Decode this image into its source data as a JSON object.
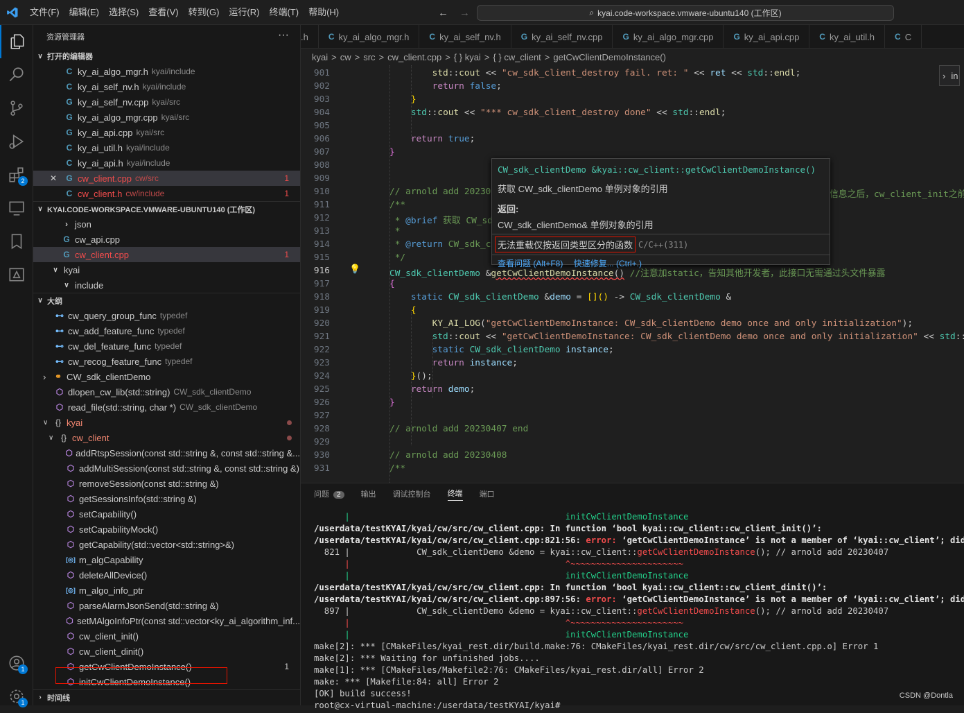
{
  "menu": [
    "文件(F)",
    "编辑(E)",
    "选择(S)",
    "查看(V)",
    "转到(G)",
    "运行(R)",
    "终端(T)",
    "帮助(H)"
  ],
  "title": "kyai.code-workspace.vmware-ubuntu140 (工作区)",
  "sidebar": {
    "header": "资源管理器",
    "open_editors_label": "打开的编辑器",
    "open_editors": [
      {
        "icon": "C",
        "name": "ky_ai_algo_mgr.h",
        "desc": "kyai/include"
      },
      {
        "icon": "C",
        "name": "ky_ai_self_nv.h",
        "desc": "kyai/include"
      },
      {
        "icon": "G",
        "name": "ky_ai_self_nv.cpp",
        "desc": "kyai/src"
      },
      {
        "icon": "G",
        "name": "ky_ai_algo_mgr.cpp",
        "desc": "kyai/src"
      },
      {
        "icon": "G",
        "name": "ky_ai_api.cpp",
        "desc": "kyai/src"
      },
      {
        "icon": "C",
        "name": "ky_ai_util.h",
        "desc": "kyai/include"
      },
      {
        "icon": "C",
        "name": "ky_ai_api.h",
        "desc": "kyai/include"
      },
      {
        "icon": "G",
        "name": "cw_client.cpp",
        "desc": "cw/src",
        "count": "1",
        "error": true
      },
      {
        "icon": "C",
        "name": "cw_client.h",
        "desc": "cw/include",
        "count": "1",
        "error": true
      }
    ],
    "workspace_label": "KYAI.CODE-WORKSPACE.VMWARE-UBUNTU140 (工作区)",
    "workspace_items": [
      {
        "name": "json",
        "kind": "folder"
      },
      {
        "name": "cw_api.cpp",
        "kind": "file"
      },
      {
        "name": "cw_client.cpp",
        "kind": "file",
        "count": "1"
      },
      {
        "name": "kyai",
        "kind": "folder-open"
      },
      {
        "name": "include",
        "kind": "folder-open"
      }
    ],
    "outline_label": "大纲",
    "outline": [
      {
        "name": "cw_query_group_func",
        "desc": "typedef",
        "kind": "td"
      },
      {
        "name": "cw_add_feature_func",
        "desc": "typedef",
        "kind": "td"
      },
      {
        "name": "cw_del_feature_func",
        "desc": "typedef",
        "kind": "td"
      },
      {
        "name": "cw_recog_feature_func",
        "desc": "typedef",
        "kind": "td"
      },
      {
        "name": "CW_sdk_clientDemo",
        "desc": "",
        "kind": "cls"
      },
      {
        "name": "dlopen_cw_lib(std::string)",
        "desc": "CW_sdk_clientDemo",
        "kind": "fn"
      },
      {
        "name": "read_file(std::string, char *)",
        "desc": "CW_sdk_clientDemo",
        "kind": "fn"
      },
      {
        "name": "kyai",
        "desc": "",
        "kind": "ns"
      },
      {
        "name": "cw_client",
        "desc": "",
        "kind": "ns"
      },
      {
        "name": "addRtspSession(const std::string &, const std::string &...",
        "desc": "",
        "kind": "fn"
      },
      {
        "name": "addMultiSession(const std::string &, const std::string &)",
        "desc": "",
        "kind": "fn"
      },
      {
        "name": "removeSession(const std::string &)",
        "desc": "",
        "kind": "fn"
      },
      {
        "name": "getSessionsInfo(std::string &)",
        "desc": "",
        "kind": "fn"
      },
      {
        "name": "setCapability()",
        "desc": "",
        "kind": "fn"
      },
      {
        "name": "setCapabilityMock()",
        "desc": "",
        "kind": "fn"
      },
      {
        "name": "getCapability(std::vector<std::string>&)",
        "desc": "",
        "kind": "fn"
      },
      {
        "name": "m_algCapability",
        "desc": "",
        "kind": "var"
      },
      {
        "name": "deleteAllDevice()",
        "desc": "",
        "kind": "fn"
      },
      {
        "name": "m_algo_info_ptr",
        "desc": "",
        "kind": "var"
      },
      {
        "name": "parseAlarmJsonSend(std::string &)",
        "desc": "",
        "kind": "fn"
      },
      {
        "name": "setMAlgoInfoPtr(const std::vector<ky_ai_algorithm_inf...",
        "desc": "",
        "kind": "fn"
      },
      {
        "name": "cw_client_init()",
        "desc": "",
        "kind": "fn"
      },
      {
        "name": "cw_client_dinit()",
        "desc": "",
        "kind": "fn"
      },
      {
        "name": "getCwClientDemoInstance()",
        "desc": "",
        "kind": "fn",
        "count": "1"
      },
      {
        "name": "initCwClientDemoInstance()",
        "desc": "",
        "kind": "fn"
      }
    ],
    "timeline_label": "时间线"
  },
  "tabs": [
    ".h",
    "ky_ai_algo_mgr.h",
    "ky_ai_self_nv.h",
    "ky_ai_self_nv.cpp",
    "ky_ai_algo_mgr.cpp",
    "ky_ai_api.cpp",
    "ky_ai_util.h",
    "C"
  ],
  "tab_icons": [
    "",
    "C",
    "C",
    "G",
    "G",
    "G",
    "C",
    "C"
  ],
  "breadcrumbs": [
    "kyai",
    ">",
    "cw",
    ">",
    "src",
    ">",
    "cw_client.cpp",
    ">",
    "{ } kyai",
    ">",
    "{ } cw_client",
    ">",
    "getCwClientDemoInstance()"
  ],
  "line_numbers": [
    "901",
    "902",
    "903",
    "904",
    "905",
    "906",
    "907",
    "908",
    "909",
    "910",
    "911",
    "912",
    "913",
    "914",
    "915",
    "916",
    "917",
    "918",
    "919",
    "920",
    "921",
    "922",
    "923",
    "924",
    "925",
    "926",
    "927",
    "928",
    "929",
    "930",
    "931"
  ],
  "hover": {
    "signature": "CW_sdk_clientDemo &kyai::cw_client::getCwClientDemoInstance()",
    "desc": "获取 CW_sdk_clientDemo 单例对象的引用",
    "returns_label": "返回:",
    "returns": "CW_sdk_clientDemo& 单例对象的引用",
    "error": "无法重载仅按返回类型区分的函数",
    "error_code": "C/C++(311)",
    "link1": "查看问题 (Alt+F8)",
    "link2": "快速修复... (Ctrl+.)"
  },
  "hint_right": "in",
  "panel": {
    "tabs": [
      "问题",
      "输出",
      "调试控制台",
      "终端",
      "端口"
    ],
    "problems_count": "2"
  },
  "terminal": [
    {
      "t": "      |                                          initCwClientDemoInstance",
      "c": "g"
    },
    {
      "t": "/userdata/testKYAI/kyai/cw/src/cw_client.cpp: In function ‘bool kyai::cw_client::cw_client_init()’:",
      "c": "b"
    },
    {
      "t": "/userdata/testKYAI/kyai/cw/src/cw_client.cpp:821:56: error: ‘getCwClientDemoInstance’ is not a member of ‘kyai::cw_client’; did you me",
      "c": "e"
    },
    {
      "t": "  821 |             CW_sdk_clientDemo &demo = kyai::cw_client::getCwClientDemoInstance(); // arnold add 20230407",
      "c": "n"
    },
    {
      "t": "      |                                          ^~~~~~~~~~~~~~~~~~~~~~~",
      "c": "r"
    },
    {
      "t": "      |                                          initCwClientDemoInstance",
      "c": "g"
    },
    {
      "t": "/userdata/testKYAI/kyai/cw/src/cw_client.cpp: In function ‘bool kyai::cw_client::cw_client_dinit()’:",
      "c": "b"
    },
    {
      "t": "/userdata/testKYAI/kyai/cw/src/cw_client.cpp:897:56: error: ‘getCwClientDemoInstance’ is not a member of ‘kyai::cw_client’; did you me",
      "c": "e"
    },
    {
      "t": "  897 |             CW_sdk_clientDemo &demo = kyai::cw_client::getCwClientDemoInstance(); // arnold add 20230407",
      "c": "n"
    },
    {
      "t": "      |                                          ^~~~~~~~~~~~~~~~~~~~~~~",
      "c": "r"
    },
    {
      "t": "      |                                          initCwClientDemoInstance",
      "c": "g"
    },
    {
      "t": "make[2]: *** [CMakeFiles/kyai_rest.dir/build.make:76: CMakeFiles/kyai_rest.dir/cw/src/cw_client.cpp.o] Error 1",
      "c": "n"
    },
    {
      "t": "make[2]: *** Waiting for unfinished jobs....",
      "c": "n"
    },
    {
      "t": "make[1]: *** [CMakeFiles/Makefile2:76: CMakeFiles/kyai_rest.dir/all] Error 2",
      "c": "n"
    },
    {
      "t": "make: *** [Makefile:84: all] Error 2",
      "c": "n"
    },
    {
      "t": "[OK] build success!",
      "c": "n"
    },
    {
      "t": "root@cx-virtual-machine:/userdata/testKYAI/kyai# ",
      "c": "n"
    }
  ],
  "watermark": "CSDN @Dontla"
}
